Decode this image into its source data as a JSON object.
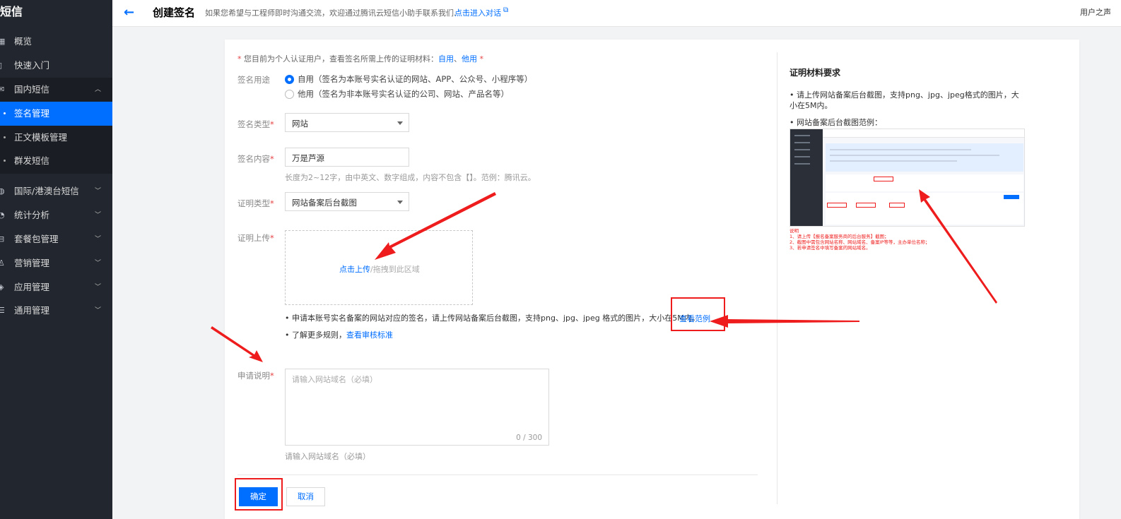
{
  "sidebar": {
    "brand": "短信",
    "items": [
      {
        "label": "概览",
        "icon": "dashboard-icon"
      },
      {
        "label": "快速入门",
        "icon": "book-icon"
      },
      {
        "label": "国内短信",
        "icon": "mail-icon"
      },
      {
        "label": "签名管理"
      },
      {
        "label": "正文模板管理"
      },
      {
        "label": "群发短信"
      },
      {
        "label": "国际/港澳台短信",
        "icon": "globe-icon"
      },
      {
        "label": "统计分析",
        "icon": "pie-chart-icon"
      },
      {
        "label": "套餐包管理",
        "icon": "package-icon"
      },
      {
        "label": "营销管理",
        "icon": "marketing-icon"
      },
      {
        "label": "应用管理",
        "icon": "layers-icon"
      },
      {
        "label": "通用管理",
        "icon": "settings-list-icon"
      }
    ]
  },
  "header": {
    "title": "创建签名",
    "desc": "如果您希望与工程师即时沟通交流，欢迎通过腾讯云短信小助手联系我们.",
    "link": "点击进入对话",
    "right_text": "用户之声"
  },
  "form": {
    "notice_prefix": "您目前为个人认证用户，查看签名所需上传的证明材料：",
    "notice_link1": "自用",
    "notice_sep": "、",
    "notice_link2": "他用",
    "purpose_label": "签名用途",
    "purpose_opt1": "自用（签名为本账号实名认证的网站、APP、公众号、小程序等）",
    "purpose_opt2": "他用（签名为非本账号实名认证的公司、网站、产品名等）",
    "type_label": "签名类型",
    "type_value": "网站",
    "content_label": "签名内容",
    "content_value": "万是芦源",
    "content_help": "长度为2~12字，由中英文、数字组成，内容不包含【】。范例：腾讯云。",
    "proof_type_label": "证明类型",
    "proof_type_value": "网站备案后台截图",
    "upload_label": "证明上传",
    "upload_link": "点击上传",
    "upload_hint": "/拖拽到此区域",
    "bullet1": "申请本账号实名备案的网站对应的签名，请上传网站备案后台截图，支持png、jpg、jpeg 格式的图片，大小在5M内。",
    "bullet1_link": "查看范例",
    "bullet2": "了解更多规则，",
    "bullet2_link": "查看审核标准",
    "reason_label": "申请说明",
    "reason_placeholder": "请输入网站域名（必填）",
    "reason_count": "0 / 300",
    "reason_help": "请输入网站域名（必填）",
    "submit": "确定",
    "cancel": "取消"
  },
  "right_panel": {
    "title": "证明材料要求",
    "item1": "请上传网站备案后台截图，支持png、jpg、jpeg格式的图片，大小在5M内。",
    "item2": "网站备案后台截图范例：",
    "note1": "说明",
    "note2": "1、请上传【报名备案服务商的后台服务】截图；",
    "note3": "2、截图中需包含网站名称、网站域名、备案IP等等，主办单位名称；",
    "note4": "3、若申请签名中填写备案的网站域名。"
  },
  "colors": {
    "accent": "#006eff",
    "annotation_red": "#ee1c1c",
    "sidebar_bg": "#22262e"
  }
}
